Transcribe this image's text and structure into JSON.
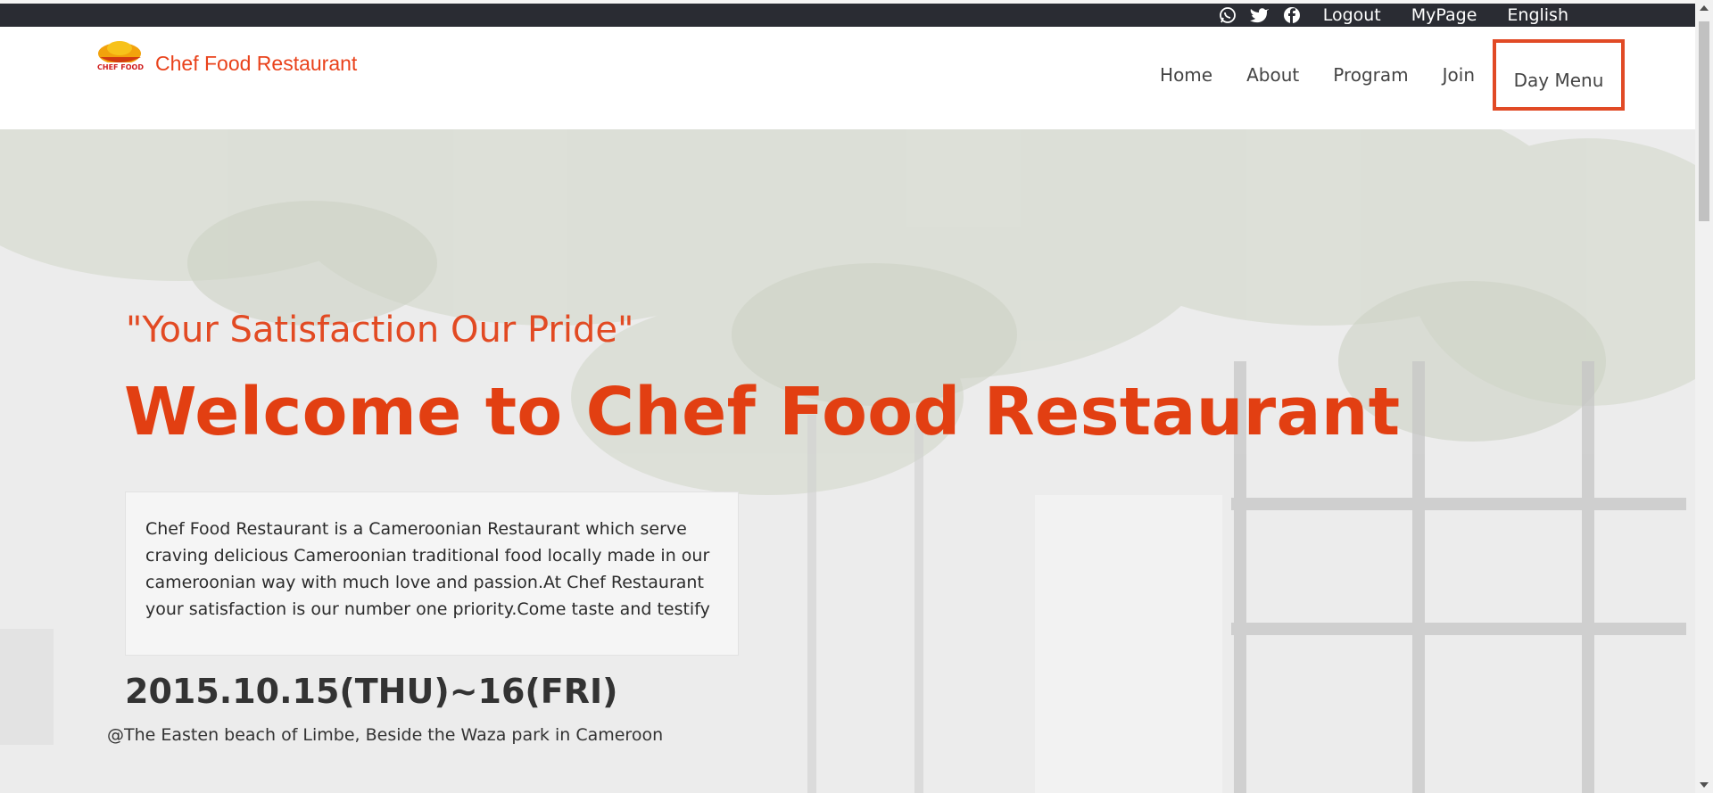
{
  "topbar": {
    "icons": [
      "whatsapp-icon",
      "twitter-icon",
      "facebook-icon"
    ],
    "links": [
      "Logout",
      "MyPage",
      "English"
    ]
  },
  "header": {
    "brand": "Chef Food Restaurant",
    "nav": [
      "Home",
      "About",
      "Program",
      "Join",
      "Day Menu"
    ]
  },
  "hero": {
    "tagline": "\"Your Satisfaction Our Pride\"",
    "title": "Welcome to Chef Food Restaurant",
    "description": "Chef Food Restaurant is a Cameroonian Restaurant which serve craving delicious Cameroonian traditional food locally made in our cameroonian way with much love and passion.At Chef Restaurant your satisfaction is our number one priority.Come taste and testify",
    "date": "2015.10.15(THU)~16(FRI)",
    "location": "@The Easten beach of Limbe, Beside the Waza park in Cameroon"
  },
  "colors": {
    "accent": "#e23f12",
    "topbar": "#2a2c33",
    "highlight_border": "#e14a25"
  }
}
